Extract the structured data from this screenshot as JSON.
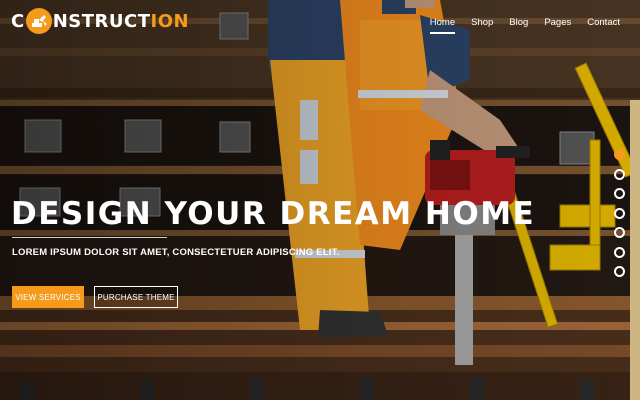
{
  "brand": {
    "prefix": "C",
    "middle": "NSTRUCT",
    "suffix": "ION",
    "accent_color": "#f59a1a",
    "mark_icon": "excavator-icon"
  },
  "nav": {
    "items": [
      {
        "label": "Home",
        "active": true
      },
      {
        "label": "Shop",
        "active": false
      },
      {
        "label": "Blog",
        "active": false
      },
      {
        "label": "Pages",
        "active": false
      },
      {
        "label": "Contact",
        "active": false
      }
    ]
  },
  "hero": {
    "headline": "DESIGN YOUR DREAM HOME",
    "subline": "LOREM IPSUM DOLOR SIT AMET, CONSECTETUER ADIPISCING ELIT.",
    "primary_button": "VIEW SERVICES",
    "secondary_button": "PURCHASE THEME",
    "slides_total": 7,
    "slide_active": 1
  }
}
